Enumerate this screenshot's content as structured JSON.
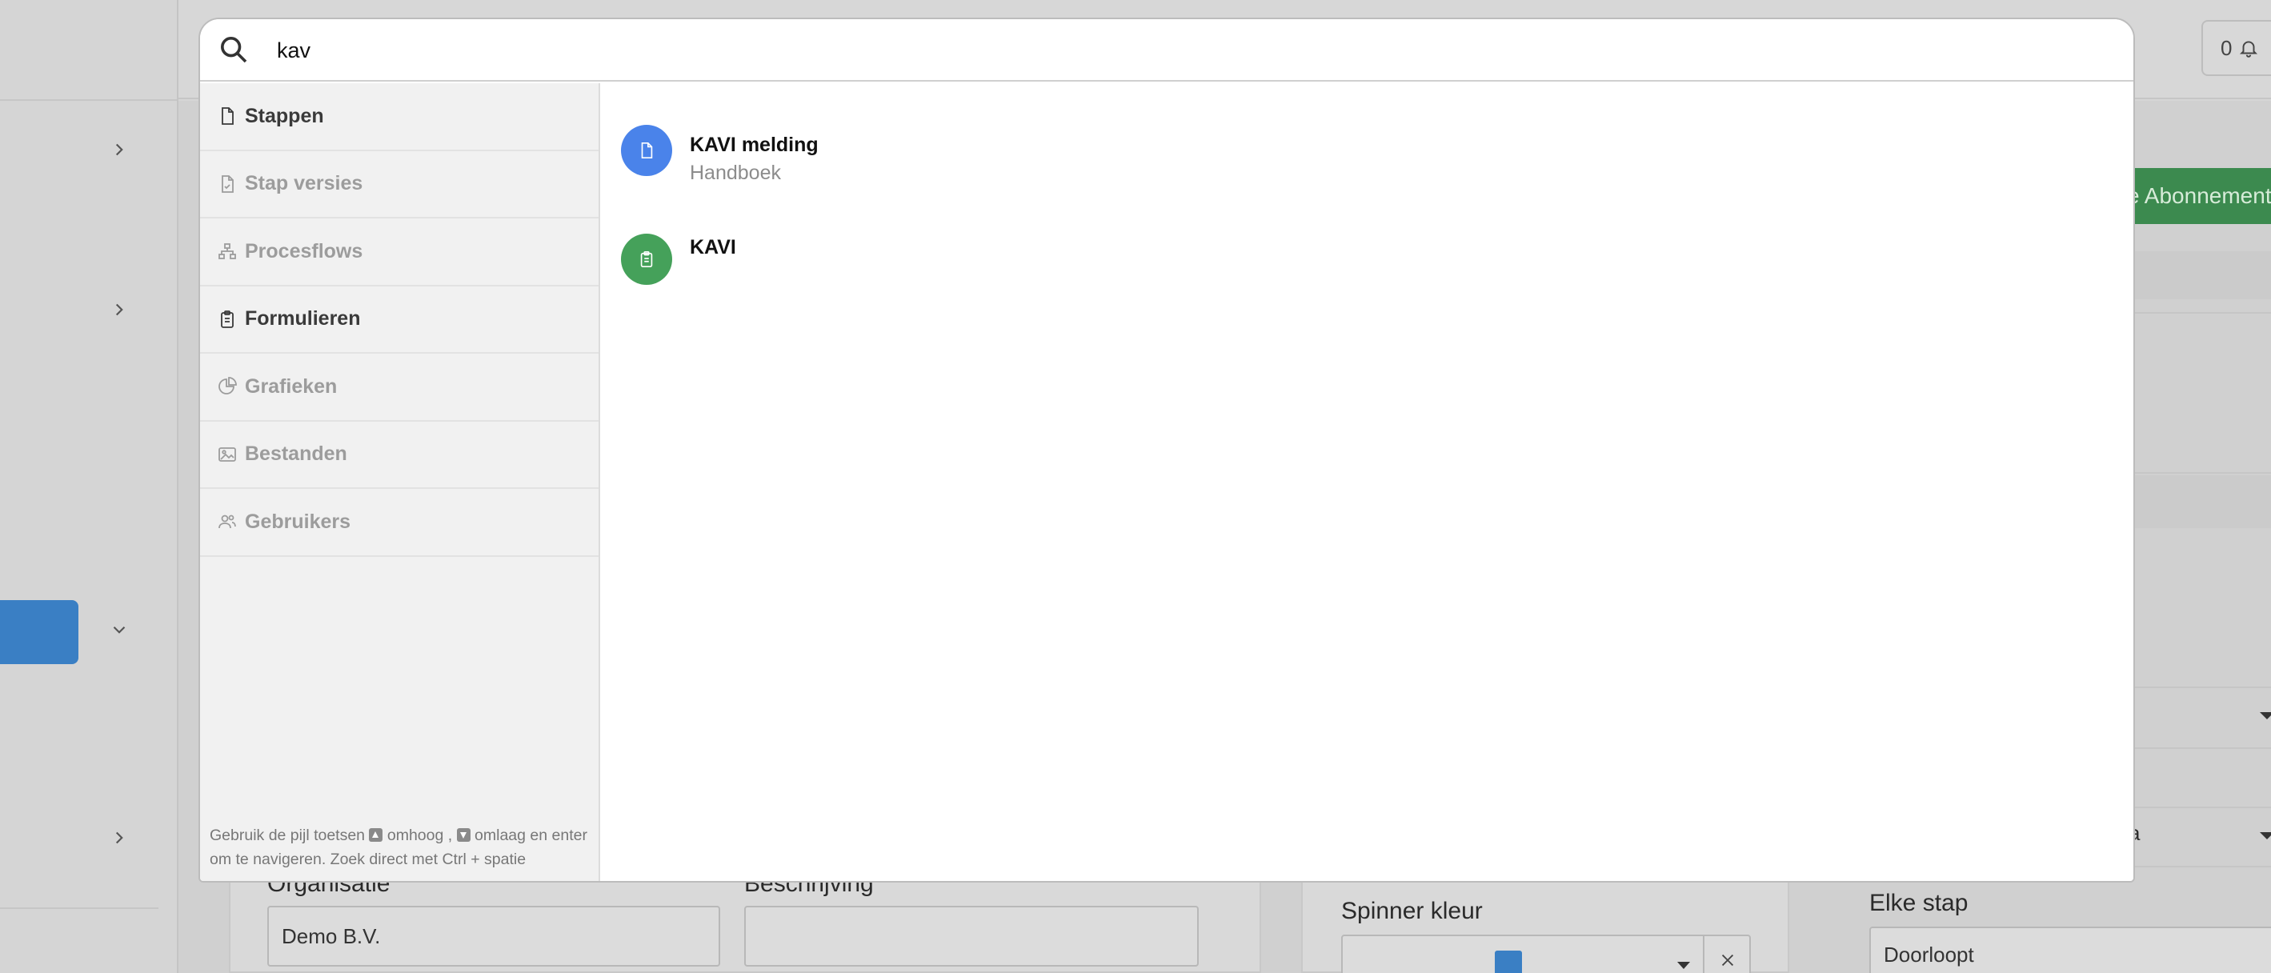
{
  "search": {
    "value": "kav",
    "placeholder": ""
  },
  "categories": [
    {
      "label": "Stappen",
      "icon": "file-icon",
      "enabled": true
    },
    {
      "label": "Stap versies",
      "icon": "file-version-icon",
      "enabled": false
    },
    {
      "label": "Procesflows",
      "icon": "flow-icon",
      "enabled": false
    },
    {
      "label": "Formulieren",
      "icon": "clipboard-icon",
      "enabled": true
    },
    {
      "label": "Grafieken",
      "icon": "pie-chart-icon",
      "enabled": false
    },
    {
      "label": "Bestanden",
      "icon": "image-folder-icon",
      "enabled": false
    },
    {
      "label": "Gebruikers",
      "icon": "users-icon",
      "enabled": false
    }
  ],
  "hint": {
    "part1": "Gebruik de pijl toetsen",
    "part2": "omhoog ,",
    "part3": "omlaag en enter om te navigeren. Zoek direct met Ctrl + spatie"
  },
  "results": [
    {
      "title": "KAVI melding",
      "subtitle": "Handboek",
      "icon": "file-icon",
      "color": "#4a83ea"
    },
    {
      "title": "KAVI",
      "subtitle": "",
      "icon": "clipboard-icon",
      "color": "#45a15a"
    }
  ],
  "background": {
    "notification_count": "0",
    "subscribe_button": "e Abonnement",
    "organisatie_label": "Organisatie",
    "organisatie_value": "Demo B.V.",
    "beschrijving_label": "Beschrijving",
    "spinner_label": "Spinner kleur",
    "spinner_color": "#3a7fc4",
    "elke_stap_label": "Elke stap",
    "elke_stap_value": "Doorloopt",
    "partial_field_value": "a"
  }
}
